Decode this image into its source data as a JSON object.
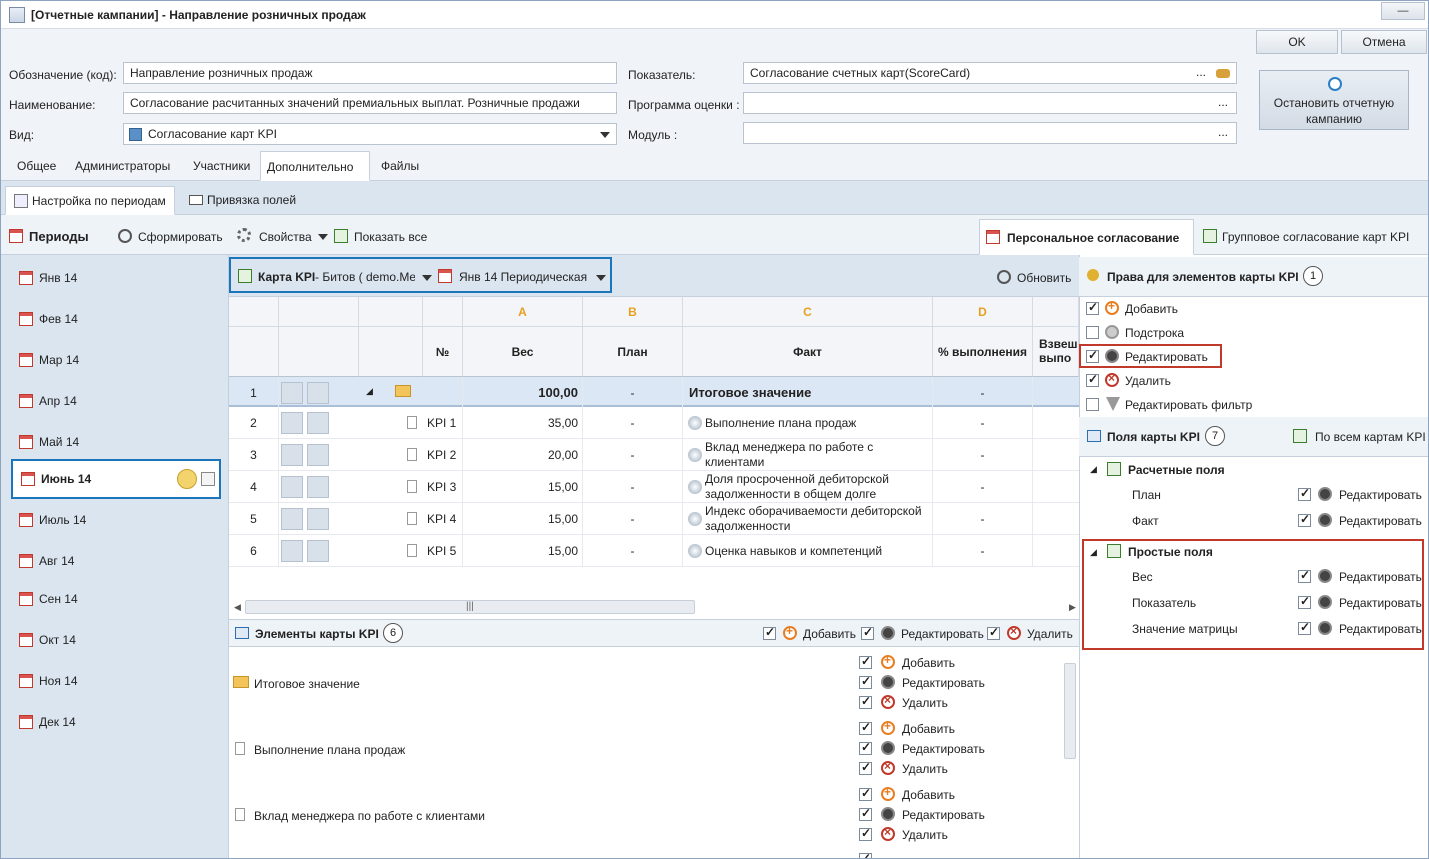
{
  "window": {
    "title": "[Отчетные кампании] - Направление розничных продаж"
  },
  "form": {
    "code_label": "Обозначение (код):",
    "code_value": "Направление розничных продаж",
    "name_label": "Наименование:",
    "name_value": "Согласование расчитанных значений премиальных выплат. Розничные продажи",
    "kind_label": "Вид:",
    "kind_value": "Согласование карт KPI",
    "indicator_label": "Показатель:",
    "indicator_value": "Согласование счетных карт(ScoreCard)",
    "program_label": "Программа оценки :",
    "module_label": "Модуль :",
    "dots": "...",
    "ok": "OK",
    "cancel": "Отмена",
    "stop_campaign": "Остановить отчетную кампанию"
  },
  "tabs": [
    "Общее",
    "Администраторы",
    "Участники",
    "Дополнительно",
    "Файлы"
  ],
  "subtabs": [
    "Настройка по периодам",
    "Привязка полей"
  ],
  "periods": {
    "title": "Периоды",
    "form_button": "Сформировать",
    "items": [
      "Янв 14",
      "Фев 14",
      "Мар 14",
      "Апр 14",
      "Май 14",
      "Июнь 14",
      "Июль 14",
      "Авг 14",
      "Сен 14",
      "Окт 14",
      "Ноя 14",
      "Дек 14"
    ],
    "selected": "Июнь 14"
  },
  "toolbar": {
    "properties": "Свойства",
    "show_all": "Показать все",
    "personal": "Персональное согласование",
    "group": "Групповое согласование карт KPI",
    "refresh": "Обновить"
  },
  "grid": {
    "kpi_card_label": "Карта KPI",
    "kpi_card_value": " - Битов ( demo.Me",
    "period_value": "Янв 14  Периодическая",
    "col_letters": [
      "A",
      "B",
      "C",
      "D"
    ],
    "headers": [
      "№",
      "Вес",
      "План",
      "Факт",
      "% выполнения",
      "Взвеш. выпо"
    ],
    "rows": [
      {
        "n": "1",
        "code": "",
        "weight": "100,00",
        "plan": "-",
        "fact": "Итоговое значение",
        "pct": "-"
      },
      {
        "n": "2",
        "code": "KPI 1",
        "weight": "35,00",
        "plan": "-",
        "fact": "Выполнение плана продаж",
        "pct": "-"
      },
      {
        "n": "3",
        "code": "KPI 2",
        "weight": "20,00",
        "plan": "-",
        "fact": "Вклад менеджера по работе с клиентами",
        "pct": "-"
      },
      {
        "n": "4",
        "code": "KPI 3",
        "weight": "15,00",
        "plan": "-",
        "fact": "Доля просроченной дебиторской задолженности в общем долге",
        "pct": "-"
      },
      {
        "n": "5",
        "code": "KPI 4",
        "weight": "15,00",
        "plan": "-",
        "fact": "Индекс оборачиваемости дебиторской задолженности",
        "pct": "-"
      },
      {
        "n": "6",
        "code": "KPI 5",
        "weight": "15,00",
        "plan": "-",
        "fact": "Оценка навыков и компетенций",
        "pct": "-"
      }
    ]
  },
  "elements": {
    "title": "Элементы карты KPI",
    "count": "6",
    "add": "Добавить",
    "edit": "Редактировать",
    "delete": "Удалить",
    "items": [
      "Итоговое значение",
      "Выполнение плана продаж",
      "Вклад менеджера по работе с клиентами"
    ]
  },
  "rights": {
    "title": "Права для элементов карты KPI",
    "count": "1",
    "items": [
      "Добавить",
      "Подстрока",
      "Редактировать",
      "Удалить",
      "Редактировать фильтр"
    ],
    "checked": [
      true,
      false,
      true,
      true,
      false
    ]
  },
  "fields": {
    "title": "Поля карты KPI",
    "count": "7",
    "all_cards": "По всем картам KPI",
    "calc_group": "Расчетные поля",
    "calc_items": [
      "План",
      "Факт"
    ],
    "simple_group": "Простые поля",
    "simple_items": [
      "Вес",
      "Показатель",
      "Значение матрицы"
    ],
    "edit": "Редактировать"
  },
  "colors": {
    "accent": "#1b75bb",
    "highlight": "#c0392b",
    "letter": "#e8a020"
  }
}
